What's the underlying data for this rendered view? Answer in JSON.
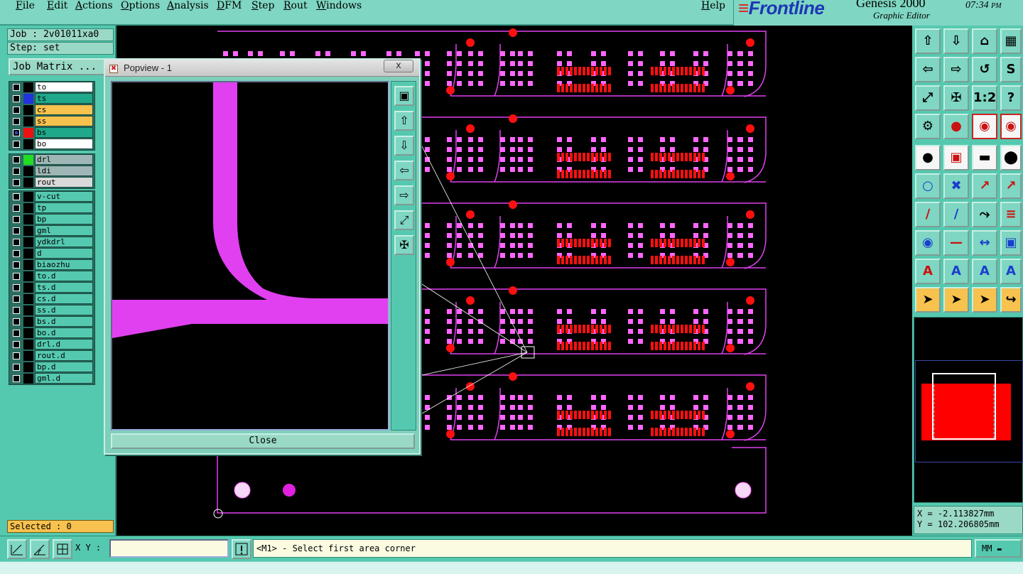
{
  "menubar": {
    "items": [
      "File",
      "Edit",
      "Actions",
      "Options",
      "Analysis",
      "DFM",
      "Step",
      "Rout",
      "Windows"
    ],
    "help": "Help"
  },
  "brand": {
    "logo": "Frontline",
    "product": "Genesis 2000",
    "subtitle": "Graphic Editor",
    "clock": "07:34",
    "clock_suffix": "PM"
  },
  "left_panel": {
    "job": "Job : 2v01011xa0",
    "step": "Step: set",
    "job_matrix_label": "Job Matrix ...",
    "board_layers": [
      {
        "name": "to",
        "swatch": "#000000",
        "fill": "#ffffff",
        "checked": false
      },
      {
        "name": "ts",
        "swatch": "#2233dd",
        "fill": "#1fa88a",
        "checked": false
      },
      {
        "name": "cs",
        "swatch": "#000000",
        "fill": "#f7c24e",
        "checked": false
      },
      {
        "name": "ss",
        "swatch": "#000000",
        "fill": "#f7c24e",
        "checked": false
      },
      {
        "name": "bs",
        "swatch": "#ee1111",
        "fill": "#1fa88a",
        "checked": true
      },
      {
        "name": "bo",
        "swatch": "#000000",
        "fill": "#ffffff",
        "checked": false
      }
    ],
    "drill_layers": [
      {
        "name": "drl",
        "swatch": "#22dd22",
        "fill": "#9fb6b6",
        "checked": false
      },
      {
        "name": "ldi",
        "swatch": "#000000",
        "fill": "#9fb6b6",
        "checked": false
      },
      {
        "name": "rout",
        "swatch": "#000000",
        "fill": "#d9d9d9",
        "checked": false
      }
    ],
    "misc_layers": [
      {
        "name": "v-cut",
        "swatch": "#000000",
        "fill": "#55c9af",
        "checked": false
      },
      {
        "name": "tp",
        "swatch": "#000000",
        "fill": "#55c9af",
        "checked": false
      },
      {
        "name": "bp",
        "swatch": "#000000",
        "fill": "#55c9af",
        "checked": false
      },
      {
        "name": "gml",
        "swatch": "#000000",
        "fill": "#55c9af",
        "checked": false
      },
      {
        "name": "ydkdrl",
        "swatch": "#000000",
        "fill": "#55c9af",
        "checked": false
      },
      {
        "name": "d",
        "swatch": "#000000",
        "fill": "#55c9af",
        "checked": false
      },
      {
        "name": "biaozhu",
        "swatch": "#000000",
        "fill": "#55c9af",
        "checked": false
      },
      {
        "name": "to.d",
        "swatch": "#000000",
        "fill": "#55c9af",
        "checked": false
      },
      {
        "name": "ts.d",
        "swatch": "#000000",
        "fill": "#55c9af",
        "checked": false
      },
      {
        "name": "cs.d",
        "swatch": "#000000",
        "fill": "#55c9af",
        "checked": false
      },
      {
        "name": "ss.d",
        "swatch": "#000000",
        "fill": "#55c9af",
        "checked": false
      },
      {
        "name": "bs.d",
        "swatch": "#000000",
        "fill": "#55c9af",
        "checked": false
      },
      {
        "name": "bo.d",
        "swatch": "#000000",
        "fill": "#55c9af",
        "checked": false
      },
      {
        "name": "drl.d",
        "swatch": "#000000",
        "fill": "#55c9af",
        "checked": false
      },
      {
        "name": "rout.d",
        "swatch": "#000000",
        "fill": "#55c9af",
        "checked": false
      },
      {
        "name": "bp.d",
        "swatch": "#000000",
        "fill": "#55c9af",
        "checked": false
      },
      {
        "name": "gml.d",
        "swatch": "#000000",
        "fill": "#55c9af",
        "checked": false
      }
    ],
    "selected": "Selected : 0"
  },
  "popview": {
    "title": "Popview - 1",
    "close_x": "x",
    "close_button": "Close",
    "tools": [
      "zoom-fit-icon",
      "move-up-icon",
      "move-down-icon",
      "move-left-icon",
      "move-right-icon",
      "zoom-out-icon",
      "zoom-in-icon"
    ]
  },
  "colors": {
    "pad": "#ff66ff",
    "trace": "#e040f0",
    "smd": "#ff1010",
    "background": "#000000",
    "panel": "#55c9af"
  },
  "toolbar": {
    "icons": [
      "zoom-home-icon",
      "zoom-back-icon",
      "home-icon",
      "layout-icon",
      "zoom-left-icon",
      "zoom-right-icon",
      "zoom-prev-icon",
      "redraw-icon",
      "zoom-fit-icon",
      "zoom-center-icon",
      "ratio-1-2-label-icon",
      "help-icon",
      "measure-tools-icon",
      "pin-icon",
      "net-highlight-icon",
      "net-split-icon",
      "add-pad-icon",
      "select-feature-icon",
      "ruler-icon",
      "circle-icon",
      "connect-icon",
      "delete-icon",
      "pad-line-icon",
      "pad-arrow-icon",
      "line-icon",
      "slant-line-icon",
      "arc-icon",
      "align-icon",
      "pad-node-icon",
      "horizontal-line-icon",
      "stretch-icon",
      "cluster-icon",
      "text-a-icon",
      "text-a-bold-icon",
      "text-a-outline-icon",
      "text-a-arrow-icon",
      "pointer-icon",
      "pointer-alt-icon",
      "pointer-circle-icon",
      "route-edit-icon"
    ]
  },
  "coords": {
    "x": "X = -2.113827mm",
    "y": "Y = 102.206805mm"
  },
  "statusbar": {
    "xy_label": "X Y :",
    "xy_value": "",
    "prompt": "<M1> - Select first area corner",
    "units": "MM"
  }
}
